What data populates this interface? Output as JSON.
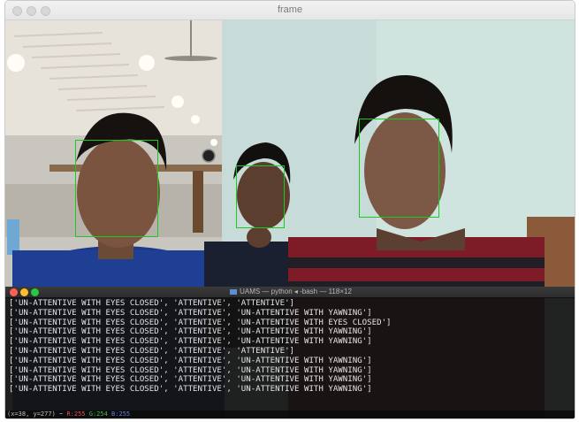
{
  "window": {
    "title": "frame"
  },
  "face_detections": {
    "color": "#1ec81e",
    "count": 3
  },
  "terminal": {
    "title": "UAMS — python ◂ -bash — 118×12",
    "folder_icon": "folder-icon",
    "lines": [
      "['UN-ATTENTIVE WITH EYES CLOSED', 'ATTENTIVE', 'ATTENTIVE']",
      "['UN-ATTENTIVE WITH EYES CLOSED', 'ATTENTIVE', 'UN-ATTENTIVE WITH YAWNING']",
      "['UN-ATTENTIVE WITH EYES CLOSED', 'ATTENTIVE', 'UN-ATTENTIVE WITH EYES CLOSED']",
      "['UN-ATTENTIVE WITH EYES CLOSED', 'ATTENTIVE', 'UN-ATTENTIVE WITH YAWNING']",
      "['UN-ATTENTIVE WITH EYES CLOSED', 'ATTENTIVE', 'UN-ATTENTIVE WITH YAWNING']",
      "['UN-ATTENTIVE WITH EYES CLOSED', 'ATTENTIVE', 'ATTENTIVE']",
      "['UN-ATTENTIVE WITH EYES CLOSED', 'ATTENTIVE', 'UN-ATTENTIVE WITH YAWNING']",
      "['UN-ATTENTIVE WITH EYES CLOSED', 'ATTENTIVE', 'UN-ATTENTIVE WITH YAWNING']",
      "['UN-ATTENTIVE WITH EYES CLOSED', 'ATTENTIVE', 'UN-ATTENTIVE WITH YAWNING']",
      "['UN-ATTENTIVE WITH EYES CLOSED', 'ATTENTIVE', 'UN-ATTENTIVE WITH YAWNING']"
    ]
  },
  "status_bar": {
    "coords": "(x=38, y=277) ~",
    "r": "R:255",
    "g": "G:254",
    "b": "B:255"
  },
  "colors": {
    "terminal_bg": "#121212",
    "close": "#ff5f57",
    "minimize": "#febc2e",
    "zoom": "#28c840"
  }
}
